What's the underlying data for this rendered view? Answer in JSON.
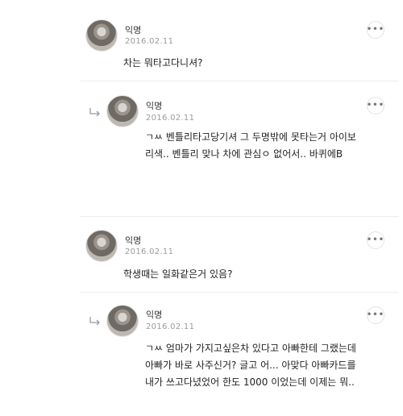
{
  "comments": [
    {
      "author": "익명",
      "date": "2016.02.11",
      "text": "차는 뭐타고다니셔?",
      "more_icon": "more-dots-icon"
    },
    {
      "author": "익명",
      "date": "2016.02.11",
      "text": "ㄱㅆ 벤틀리타고당기셔 그 두명밖에 못타는거 아이보리색.. 벤틀리 맞나 차에 관심ㅇ 없어서.. 바퀴에B",
      "reply_icon": "reply-arrow-icon",
      "more_icon": "more-dots-icon"
    },
    {
      "author": "익명",
      "date": "2016.02.11",
      "text": "학생때는 일화같은거 있음?",
      "more_icon": "more-dots-icon"
    },
    {
      "author": "익명",
      "date": "2016.02.11",
      "text": "ㄱㅆ 엄마가 가지고싶은차 있다고 아빠한테 그랬는데 아빠가 바로 사주신거? 글고 어... 아맞다 아빠카드를 내가 쓰고다녔었어 한도 1000 이었는데 이제는 뭐..",
      "reply_icon": "reply-arrow-icon",
      "more_icon": "more-dots-icon"
    }
  ],
  "colors": {
    "text": "#222222",
    "date": "#9b9b9b",
    "divider": "#ededed"
  }
}
